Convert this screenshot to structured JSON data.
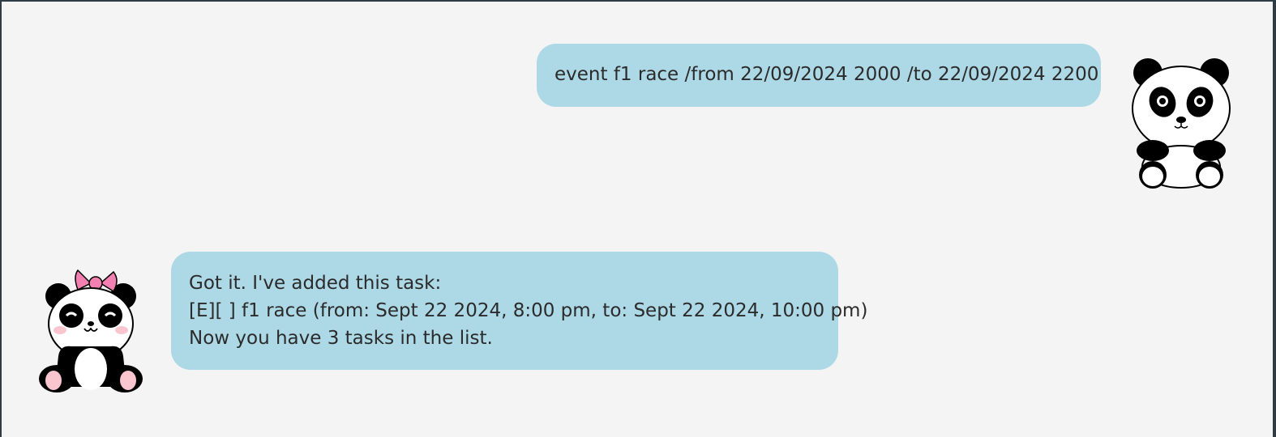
{
  "conversation": {
    "user_message": {
      "text": "event f1 race /from 22/09/2024 2000 /to 22/09/2024 2200",
      "avatar_icon": "panda-avatar-icon"
    },
    "bot_message": {
      "lines": [
        "Got it. I've added this task:",
        "[E][ ] f1 race (from: Sept 22 2024, 8:00 pm, to: Sept 22 2024, 10:00 pm)",
        "Now you have 3 tasks in the list."
      ],
      "avatar_icon": "panda-with-bow-avatar-icon"
    }
  },
  "colors": {
    "background": "#f4f4f4",
    "bubble": "#add8e6",
    "text": "#2b2b2b",
    "bow": "#f47fb1",
    "cheeks": "#f9c6d0"
  }
}
